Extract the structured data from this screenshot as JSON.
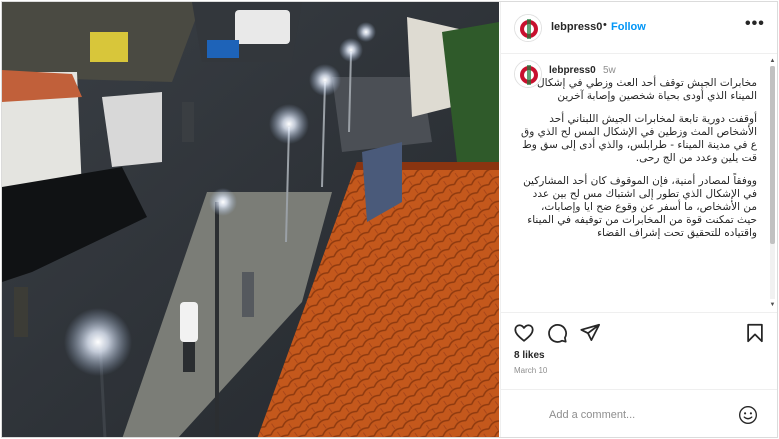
{
  "post": {
    "username": "lebpress0",
    "follow_label": "Follow",
    "dot": "•",
    "more_icon": "more-horizontal-icon"
  },
  "caption": {
    "username": "lebpress0",
    "time": "5w",
    "paragraphs": [
      "مخابرات الجيش توقف أحد العث وزطي في إشكال الميناء الذي أودى بحياة شخصين وإصابة آخرين",
      "أوقفت دورية تابعة لمخابرات الجيش اللبناني أحد الأشخاص المث وزطين في الإشكال المس لح الذي وق ع في مدينة الميناء - طرابلس، والذي أدى إلى سق وط قت يلين وعدد من الج رحى.",
      "ووفقاً لمصادر أمنية، فإن الموقوف كان أحد المشاركين في الإشكال الذي تطور إلى اشتباك مس لح بين عدد من الأشخاص، ما أسفر عن وقوع ضح ايا وإصابات، حيث تمكنت قوة من المخابرات من توقيفه في الميناء واقتياده للتحقيق تحت إشراف القضاء"
    ]
  },
  "actions": {
    "like_icon": "heart-icon",
    "comment_icon": "comment-icon",
    "share_icon": "share-icon",
    "save_icon": "bookmark-icon"
  },
  "likes": "8 likes",
  "date": "March 10",
  "comment_box": {
    "placeholder": "Add a comment...",
    "emoji_icon": "smile-icon"
  },
  "colors": {
    "follow": "#0095f6",
    "text": "#262626",
    "muted": "#8e8e8e",
    "border": "#dbdbdb",
    "roof": "#c85a1e"
  }
}
